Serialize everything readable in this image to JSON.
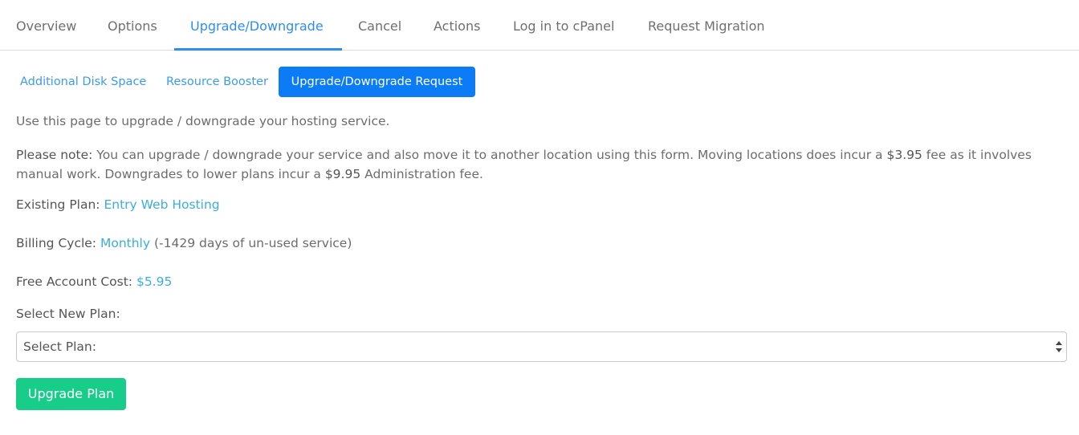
{
  "tabs": [
    {
      "label": "Overview"
    },
    {
      "label": "Options"
    },
    {
      "label": "Upgrade/Downgrade",
      "active": true
    },
    {
      "label": "Cancel"
    },
    {
      "label": "Actions"
    },
    {
      "label": "Log in to cPanel"
    },
    {
      "label": "Request Migration"
    }
  ],
  "subnav": {
    "items": [
      {
        "label": "Additional Disk Space"
      },
      {
        "label": "Resource Booster"
      },
      {
        "label": "Upgrade/Downgrade Request",
        "active": true
      }
    ]
  },
  "content": {
    "intro": "Use this page to upgrade / downgrade your hosting service.",
    "note": {
      "label": "Please note:",
      "part1": " You can upgrade / downgrade your service and also move it to another location using this form. Moving locations does incur a ",
      "fee1": "$3.95",
      "part2": " fee as it involves manual work. Downgrades to lower plans incur a ",
      "fee2": "$9.95",
      "part3": " Administration fee."
    },
    "existing_plan": {
      "label": "Existing Plan:",
      "value": "Entry Web Hosting"
    },
    "billing_cycle": {
      "label": "Billing Cycle:",
      "value": "Monthly",
      "suffix": "(-1429 days of un-used service)"
    },
    "free_account_cost": {
      "label": "Free Account Cost:",
      "value": "$5.95"
    },
    "select_plan": {
      "label": "Select New Plan:",
      "selected": "Select Plan:"
    },
    "upgrade_button": "Upgrade Plan"
  },
  "colors": {
    "accent_blue": "#2e8ef0",
    "link_blue": "#3d9be9",
    "pill_blue": "#0b7cf6",
    "value_teal": "#3aaedf",
    "button_green": "#18cc8a"
  }
}
